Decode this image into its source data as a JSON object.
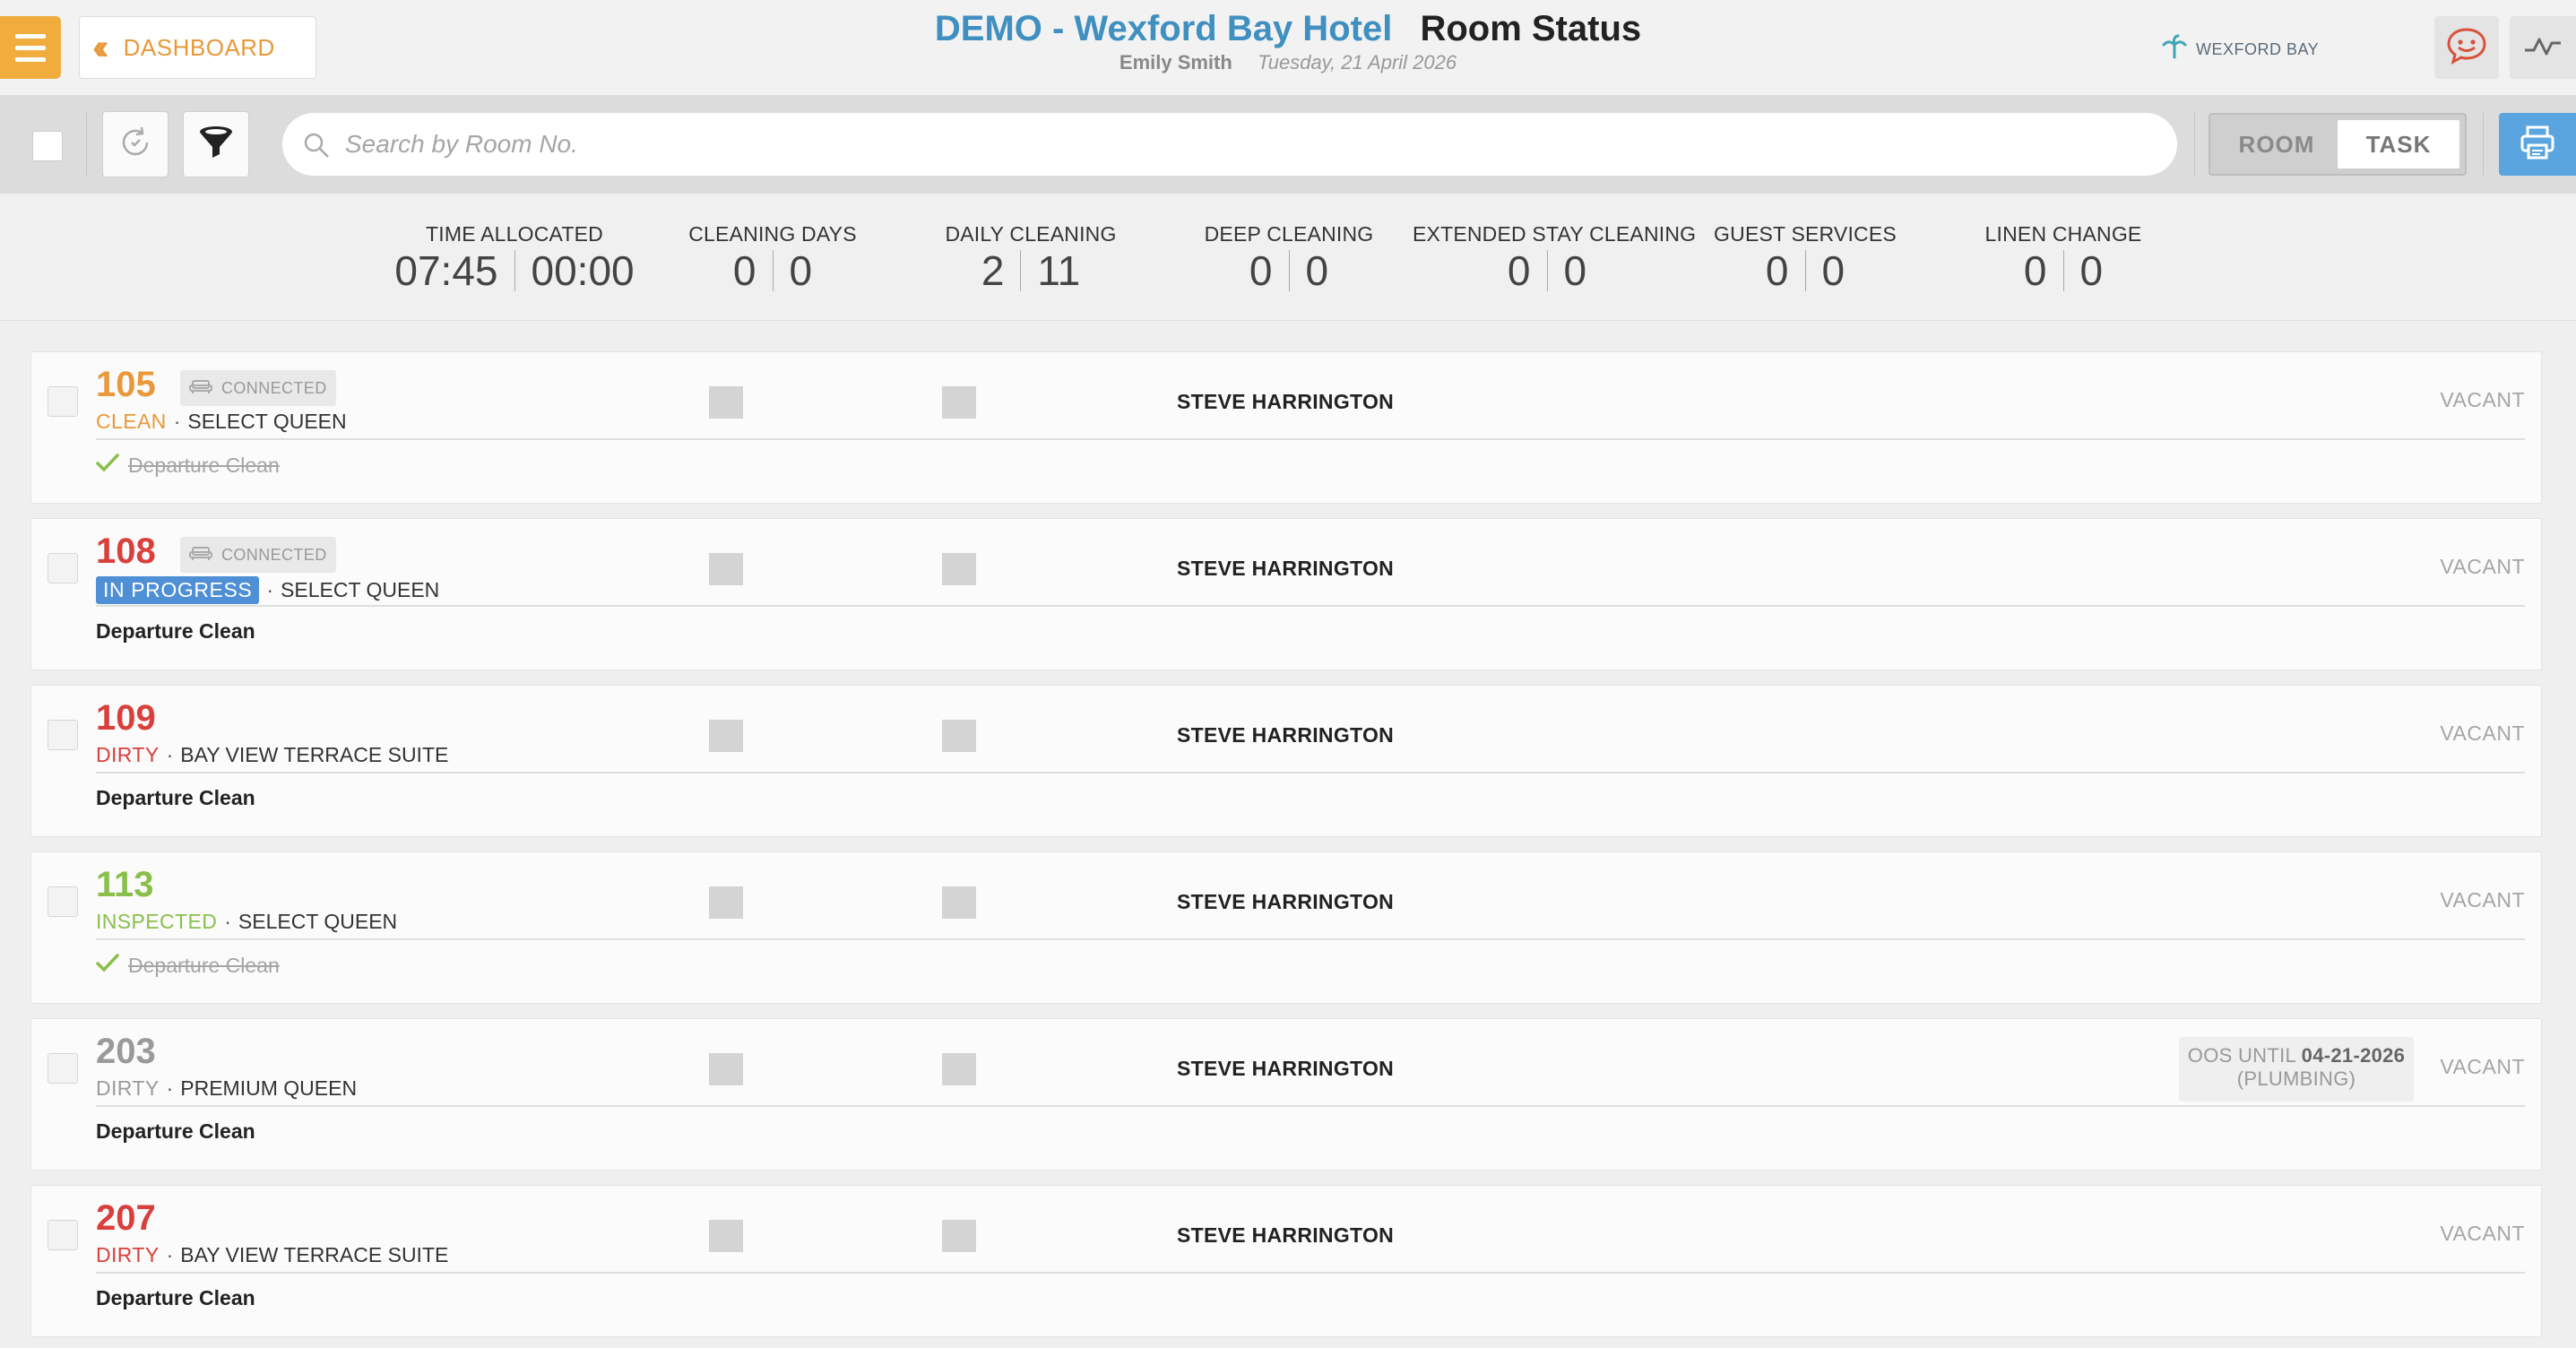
{
  "header": {
    "dashboard_label": "DASHBOARD",
    "hotel_title": "DEMO - Wexford Bay Hotel",
    "page_title": "Room Status",
    "user_name": "Emily Smith",
    "date": "Tuesday, 21 April 2026",
    "hotel_logo_text": "WEXFORD BAY",
    "icons": {
      "menu": "hamburger-icon",
      "back": "double-chevron-left-icon",
      "chat": "chat-face-icon",
      "activity": "activity-line-icon",
      "logo": "palm-leaf-icon"
    }
  },
  "toolbar": {
    "search_placeholder": "Search by Room No.",
    "view_toggle": {
      "room_label": "ROOM",
      "task_label": "TASK",
      "selected": "TASK"
    },
    "icons": {
      "refresh": "refresh-icon",
      "filter": "filter-funnel-icon",
      "search": "search-icon",
      "print": "printer-icon"
    }
  },
  "stats": [
    {
      "label": "TIME ALLOCATED",
      "left": "07:45",
      "right": "00:00"
    },
    {
      "label": "CLEANING DAYS",
      "left": "0",
      "right": "0"
    },
    {
      "label": "DAILY CLEANING",
      "left": "2",
      "right": "11"
    },
    {
      "label": "DEEP CLEANING",
      "left": "0",
      "right": "0"
    },
    {
      "label": "EXTENDED STAY CLEANING",
      "left": "0",
      "right": "0"
    },
    {
      "label": "GUEST SERVICES",
      "left": "0",
      "right": "0"
    },
    {
      "label": "LINEN CHANGE",
      "left": "0",
      "right": "0"
    }
  ],
  "rooms": [
    {
      "number": "105",
      "number_color": "#e8993a",
      "connected": "CONNECTED",
      "status": "CLEAN",
      "status_color": "#e8993a",
      "status_style": "text",
      "room_type": "SELECT QUEEN",
      "task": "Departure Clean",
      "task_done": true,
      "staff": "STEVE HARRINGTON",
      "occupancy": "VACANT"
    },
    {
      "number": "108",
      "number_color": "#d9403c",
      "connected": "CONNECTED",
      "status": "IN PROGRESS",
      "status_color": "#4e8fd6",
      "status_style": "badge",
      "room_type": "SELECT QUEEN",
      "task": "Departure Clean",
      "task_done": false,
      "staff": "STEVE HARRINGTON",
      "occupancy": "VACANT"
    },
    {
      "number": "109",
      "number_color": "#d9403c",
      "status": "DIRTY",
      "status_color": "#d9403c",
      "status_style": "text",
      "room_type": "BAY VIEW TERRACE SUITE",
      "task": "Departure Clean",
      "task_done": false,
      "staff": "STEVE HARRINGTON",
      "occupancy": "VACANT"
    },
    {
      "number": "113",
      "number_color": "#8bbf4b",
      "status": "INSPECTED",
      "status_color": "#8bbf4b",
      "status_style": "text",
      "room_type": "SELECT QUEEN",
      "task": "Departure Clean",
      "task_done": true,
      "staff": "STEVE HARRINGTON",
      "occupancy": "VACANT"
    },
    {
      "number": "203",
      "number_color": "#9a9a9a",
      "status": "DIRTY",
      "status_color": "#9a9a9a",
      "status_style": "text",
      "room_type": "PREMIUM QUEEN",
      "task": "Departure Clean",
      "task_done": false,
      "staff": "STEVE HARRINGTON",
      "occupancy": "VACANT",
      "oos_prefix": "OOS UNTIL",
      "oos_date": "04-21-2026",
      "oos_reason": "(PLUMBING)"
    },
    {
      "number": "207",
      "number_color": "#d9403c",
      "status": "DIRTY",
      "status_color": "#d9403c",
      "status_style": "text",
      "room_type": "BAY VIEW TERRACE SUITE",
      "task": "Departure Clean",
      "task_done": false,
      "staff": "STEVE HARRINGTON",
      "occupancy": "VACANT"
    }
  ],
  "colors": {
    "accent_orange": "#f0ad3e",
    "hotel_blue": "#3f8fc0",
    "print_blue": "#5aa5e0",
    "check_green": "#8bbf4b"
  }
}
